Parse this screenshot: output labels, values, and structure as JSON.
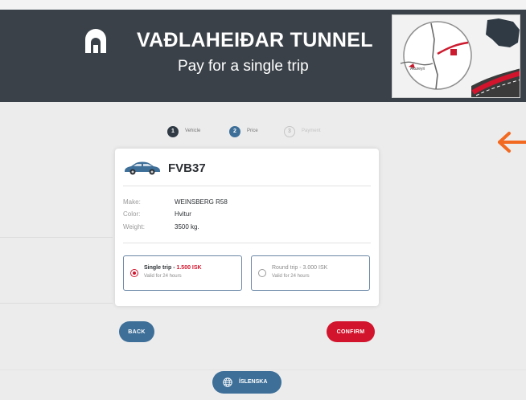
{
  "header": {
    "title": "VAÐLAHEIÐAR TUNNEL",
    "subtitle": "Pay for a single trip",
    "map_label": "Akureyri"
  },
  "stepper": [
    {
      "number": "1",
      "label": "Vehicle",
      "state": "done"
    },
    {
      "number": "2",
      "label": "Price",
      "state": "active"
    },
    {
      "number": "3",
      "label": "Payment",
      "state": "todo"
    }
  ],
  "vehicle": {
    "plate": "FVB37",
    "specs": [
      {
        "key": "Make:",
        "value": "WEINSBERG R58"
      },
      {
        "key": "Color:",
        "value": "Hvitur"
      },
      {
        "key": "Weight:",
        "value": "3500 kg."
      }
    ]
  },
  "options": {
    "single": {
      "label": "Single trip",
      "price": "1.500 ISK",
      "sub": "Valid for 24 hours",
      "selected": true
    },
    "round": {
      "label": "Round trip",
      "price": "3.000 ISK",
      "sub": "Valid for 24 hours",
      "selected": false
    }
  },
  "buttons": {
    "back": "BACK",
    "confirm": "CONFIRM",
    "language": "ÍSLENSKA"
  },
  "colors": {
    "header_bg": "#3a4148",
    "accent_blue": "#3d6f99",
    "accent_red": "#d2152d",
    "annotation_orange": "#f26a21"
  }
}
